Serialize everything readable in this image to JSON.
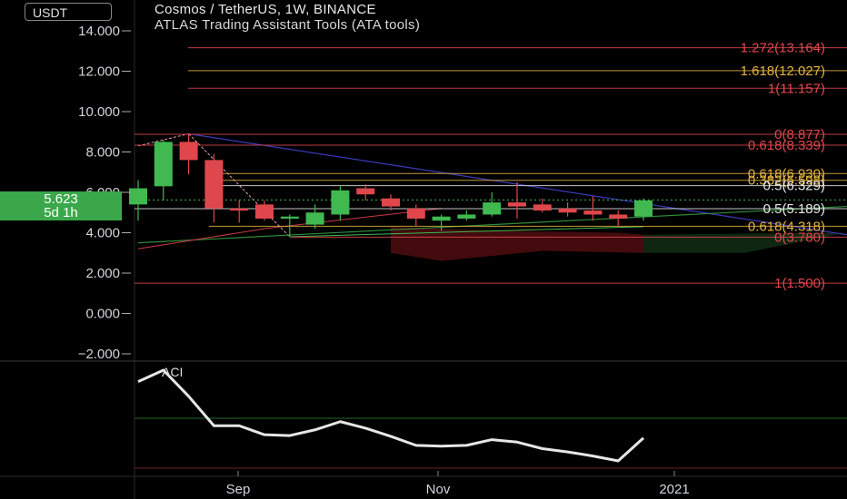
{
  "header": {
    "currency": "USDT",
    "title": "Cosmos / TetherUS, 1W, BINANCE",
    "indicator": "ATLAS Trading Assistant Tools (ATA tools)"
  },
  "price_tag": {
    "price": "5.623",
    "countdown": "5d 1h"
  },
  "oscillator": {
    "label": "ACI"
  },
  "colors": {
    "up": "#3fb950",
    "down": "#e0474c",
    "bg": "#000000"
  },
  "chart_data": [
    {
      "type": "candlestick",
      "title": "Cosmos / TetherUS, 1W, BINANCE",
      "ylabel": "USDT",
      "ylim": [
        -2.6,
        15.0
      ],
      "y_ticks": [
        14,
        12,
        10,
        8,
        6,
        4,
        2,
        0,
        -2
      ],
      "y_tick_labels": [
        "14.000",
        "12.000",
        "10.000",
        "8.000",
        "6.000",
        "4.000",
        "2.000",
        "0.000",
        "−2.000"
      ],
      "x_tick_labels": [
        "Sep",
        "Nov",
        "2021"
      ],
      "candles": [
        {
          "o": 5.4,
          "h": 6.6,
          "l": 4.6,
          "c": 6.2
        },
        {
          "o": 6.3,
          "h": 8.6,
          "l": 5.6,
          "c": 8.5
        },
        {
          "o": 8.5,
          "h": 8.9,
          "l": 6.9,
          "c": 7.6
        },
        {
          "o": 7.6,
          "h": 7.9,
          "l": 4.5,
          "c": 5.2
        },
        {
          "o": 5.2,
          "h": 5.6,
          "l": 4.5,
          "c": 5.1
        },
        {
          "o": 5.4,
          "h": 5.6,
          "l": 4.6,
          "c": 4.7
        },
        {
          "o": 4.7,
          "h": 4.9,
          "l": 3.8,
          "c": 4.8
        },
        {
          "o": 4.4,
          "h": 5.4,
          "l": 4.2,
          "c": 5.0
        },
        {
          "o": 4.9,
          "h": 6.3,
          "l": 4.6,
          "c": 6.1
        },
        {
          "o": 6.2,
          "h": 6.4,
          "l": 5.6,
          "c": 5.9
        },
        {
          "o": 5.7,
          "h": 5.9,
          "l": 5.1,
          "c": 5.3
        },
        {
          "o": 5.2,
          "h": 5.4,
          "l": 4.3,
          "c": 4.7
        },
        {
          "o": 4.6,
          "h": 4.9,
          "l": 4.1,
          "c": 4.8
        },
        {
          "o": 4.7,
          "h": 5.1,
          "l": 4.6,
          "c": 4.9
        },
        {
          "o": 4.9,
          "h": 6.0,
          "l": 4.8,
          "c": 5.5
        },
        {
          "o": 5.5,
          "h": 6.5,
          "l": 4.7,
          "c": 5.3
        },
        {
          "o": 5.4,
          "h": 5.7,
          "l": 5.0,
          "c": 5.1
        },
        {
          "o": 5.2,
          "h": 5.5,
          "l": 4.8,
          "c": 5.0
        },
        {
          "o": 5.1,
          "h": 5.8,
          "l": 4.6,
          "c": 4.9
        },
        {
          "o": 4.9,
          "h": 5.1,
          "l": 4.3,
          "c": 4.7
        },
        {
          "o": 4.8,
          "h": 5.7,
          "l": 4.6,
          "c": 5.6
        }
      ],
      "levels": [
        {
          "label": "1.272(13.164)",
          "value": 13.164,
          "color": "#e0474c"
        },
        {
          "label": "1.618(12.027)",
          "value": 12.027,
          "color": "#e3b341"
        },
        {
          "label": "1(11.157)",
          "value": 11.157,
          "color": "#e0474c"
        },
        {
          "label": "0(8.877)",
          "value": 8.877,
          "color": "#e0474c"
        },
        {
          "label": "0.618(8.339)",
          "value": 8.339,
          "color": "#e0474c"
        },
        {
          "label": "0.618(6.930)",
          "value": 6.93,
          "color": "#e3b341"
        },
        {
          "label": "0.382(6.598)",
          "value": 6.598,
          "color": "#e3b341"
        },
        {
          "label": "0.5(6.329)",
          "value": 6.329,
          "color": "#e8e8e8"
        },
        {
          "label": "0.5(5.189)",
          "value": 5.189,
          "color": "#e8e8e8"
        },
        {
          "label": "0.618(4.318)",
          "value": 4.318,
          "color": "#e3b341"
        },
        {
          "label": "0(3.780)",
          "value": 3.78,
          "color": "#e0474c"
        },
        {
          "label": "1(1.500)",
          "value": 1.5,
          "color": "#e0474c"
        }
      ],
      "current_price": 5.623
    },
    {
      "type": "line",
      "title": "ACI",
      "values": [
        0.86,
        1.0,
        0.68,
        0.32,
        0.32,
        0.21,
        0.2,
        0.27,
        0.37,
        0.29,
        0.19,
        0.08,
        0.07,
        0.08,
        0.15,
        0.12,
        0.04,
        0.0,
        -0.05,
        -0.11,
        0.17
      ],
      "ylim": [
        -0.3,
        1.1
      ]
    }
  ]
}
